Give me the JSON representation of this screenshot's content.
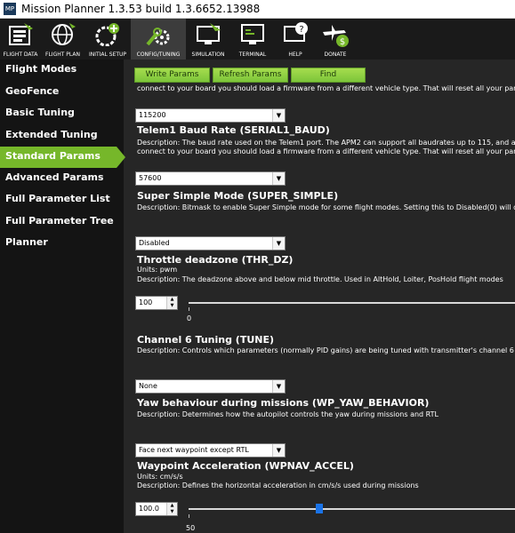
{
  "window": {
    "logo": "MP",
    "title": "Mission Planner 1.3.53 build 1.3.6652.13988"
  },
  "toolbar": [
    {
      "label": "FLIGHT DATA",
      "icon": "flight-data-icon"
    },
    {
      "label": "FLIGHT PLAN",
      "icon": "globe-icon"
    },
    {
      "label": "INITIAL SETUP",
      "icon": "initial-setup-icon"
    },
    {
      "label": "CONFIG/TUNING",
      "icon": "gear-wrench-icon"
    },
    {
      "label": "SIMULATION",
      "icon": "simulation-icon"
    },
    {
      "label": "TERMINAL",
      "icon": "terminal-icon"
    },
    {
      "label": "HELP",
      "icon": "help-icon"
    },
    {
      "label": "DONATE",
      "icon": "donate-icon"
    }
  ],
  "sidebar": {
    "items": [
      {
        "label": "Flight Modes"
      },
      {
        "label": "GeoFence"
      },
      {
        "label": "Basic Tuning"
      },
      {
        "label": "Extended Tuning"
      },
      {
        "label": "Standard Params"
      },
      {
        "label": "Advanced Params"
      },
      {
        "label": "Full Parameter List"
      },
      {
        "label": "Full Parameter Tree"
      },
      {
        "label": "Planner"
      }
    ]
  },
  "buttons": {
    "write": "Write Params",
    "refresh": "Refresh Params",
    "find": "Find"
  },
  "top_desc": "connect to your board you should load a firmware from a different vehicle type.  That will reset all your parameters",
  "serial1": {
    "value": "115200",
    "title": "Telem1 Baud Rate (SERIAL1_BAUD)",
    "desc1": "Description: The baud rate used on the Telem1 port. The APM2 can support all baudrates up to 115, and also c",
    "desc2": "connect to your board you should load a firmware from a different vehicle type.  That will reset all your parameter"
  },
  "super_simple": {
    "value": "57600",
    "title": "Super Simple Mode (SUPER_SIMPLE)",
    "desc": "Description: Bitmask to enable Super Simple mode for some flight modes. Setting this to Disabled(0) will disable"
  },
  "thr_dz": {
    "value": "Disabled",
    "title": "Throttle deadzone (THR_DZ)",
    "units": "Units: pwm",
    "desc": "Description: The deadzone above and below mid throttle.  Used in AltHold, Loiter, PosHold flight modes",
    "spin": "100",
    "tick": "0",
    "position": 0.0
  },
  "tune": {
    "title": "Channel 6 Tuning (TUNE)",
    "desc": "Description: Controls which parameters (normally PID gains) are being tuned with transmitter's channel 6 knob"
  },
  "yaw": {
    "value": "None",
    "title": "Yaw behaviour during missions (WP_YAW_BEHAVIOR)",
    "desc": "Description: Determines how the autopilot controls the yaw during missions and RTL"
  },
  "wpnav": {
    "value": "Face next waypoint except RTL",
    "title": "Waypoint Acceleration (WPNAV_ACCEL)",
    "units": "Units: cm/s/s",
    "desc": "Description: Defines the horizontal acceleration in cm/s/s used during missions",
    "spin": "100.0",
    "tick": "50",
    "position": 0.4
  },
  "colors": {
    "accent": "#76b72a",
    "slider_thumb": "#1a73e8",
    "panel": "#262626",
    "sidebar": "#141414"
  }
}
